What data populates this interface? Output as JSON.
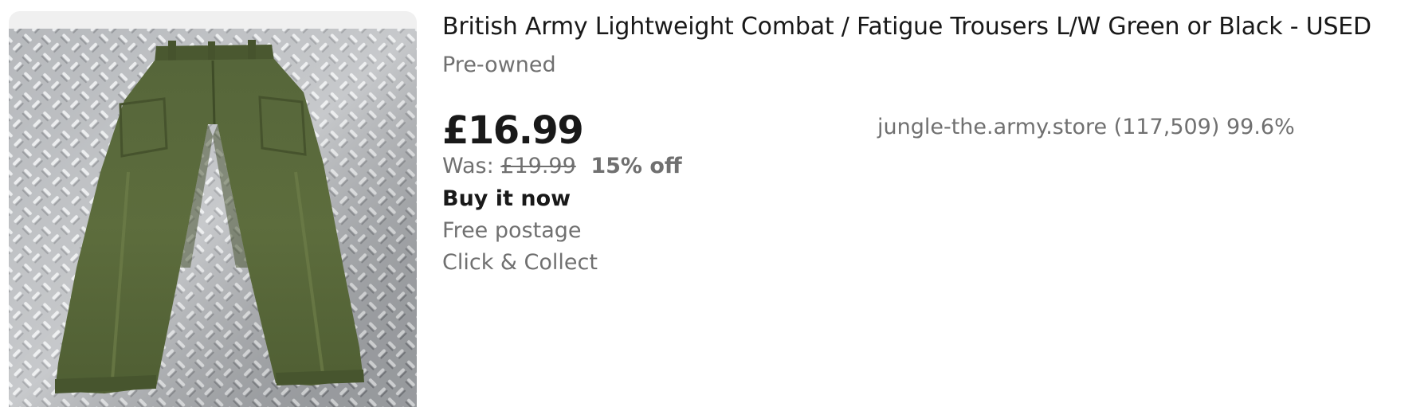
{
  "listing": {
    "title": "British Army Lightweight Combat / Fatigue Trousers L/W Green or Black - USED",
    "condition": "Pre-owned",
    "price": "£16.99",
    "was_label": "Was:",
    "was_price": "£19.99",
    "discount": "15% off",
    "buying_format": "Buy it now",
    "postage": "Free postage",
    "collection": "Click & Collect",
    "seller": "jungle-the.army.store (117,509) 99.6%",
    "image_alt": "Olive green combat trousers on a metal chequer plate floor"
  },
  "colors": {
    "title_text": "#191919",
    "secondary_text": "#707070",
    "trouser_green": "#5b6b3a",
    "image_background": "#f0f0f0"
  }
}
